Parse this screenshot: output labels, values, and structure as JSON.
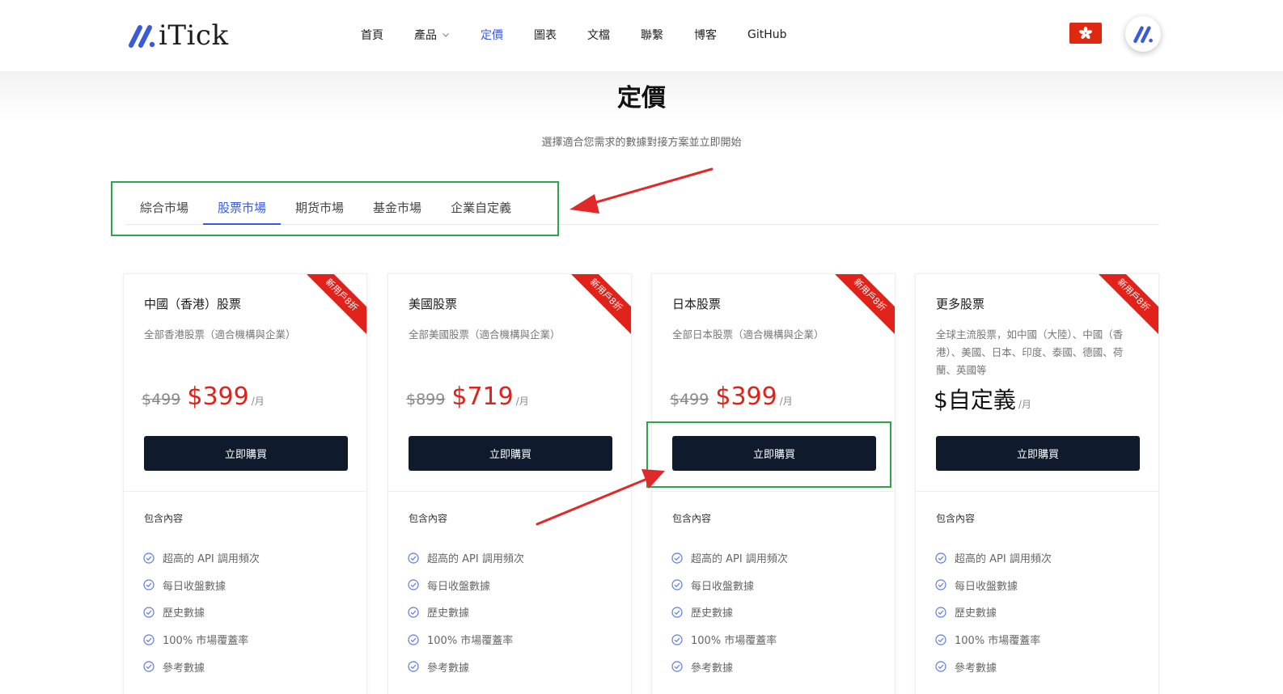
{
  "brand": {
    "logo_text": "iTick",
    "accent": "#3a5bd9"
  },
  "nav": {
    "items": [
      {
        "label": "首頁",
        "active": false,
        "has_dropdown": false
      },
      {
        "label": "產品",
        "active": false,
        "has_dropdown": true
      },
      {
        "label": "定價",
        "active": true,
        "has_dropdown": false
      },
      {
        "label": "圖表",
        "active": false,
        "has_dropdown": false
      },
      {
        "label": "文檔",
        "active": false,
        "has_dropdown": false
      },
      {
        "label": "聯繫",
        "active": false,
        "has_dropdown": false
      },
      {
        "label": "博客",
        "active": false,
        "has_dropdown": false
      },
      {
        "label": "GitHub",
        "active": false,
        "has_dropdown": false
      }
    ]
  },
  "page": {
    "title": "定價",
    "subtitle": "選擇適合您需求的數據對接方案並立即開始"
  },
  "tabs": [
    {
      "label": "綜合市場",
      "active": false
    },
    {
      "label": "股票市場",
      "active": true
    },
    {
      "label": "期货市場",
      "active": false
    },
    {
      "label": "基金市場",
      "active": false
    },
    {
      "label": "企業自定義",
      "active": false
    }
  ],
  "cards": [
    {
      "ribbon": "新用戶8折",
      "title": "中國（香港）股票",
      "desc": "全部香港股票（適合機構與企業）",
      "old_price": "$499",
      "price": "$399",
      "per": "/月",
      "button": "立即購買",
      "includes_label": "包含內容",
      "features": [
        "超高的 API 調用頻次",
        "每日收盤數據",
        "歷史數據",
        "100% 市場覆蓋率",
        "參考數據"
      ]
    },
    {
      "ribbon": "新用戶8折",
      "title": "美國股票",
      "desc": "全部美國股票（適合機構與企業）",
      "old_price": "$899",
      "price": "$719",
      "per": "/月",
      "button": "立即購買",
      "includes_label": "包含內容",
      "features": [
        "超高的 API 調用頻次",
        "每日收盤數據",
        "歷史數據",
        "100% 市場覆蓋率",
        "參考數據"
      ]
    },
    {
      "ribbon": "新用戶8折",
      "title": "日本股票",
      "desc": "全部日本股票（適合機構與企業）",
      "old_price": "$499",
      "price": "$399",
      "per": "/月",
      "button": "立即購買",
      "includes_label": "包含內容",
      "features": [
        "超高的 API 調用頻次",
        "每日收盤數據",
        "歷史數據",
        "100% 市場覆蓋率",
        "參考數據"
      ]
    },
    {
      "ribbon": "新用戶8折",
      "title": "更多股票",
      "desc": "全球主流股票，如中國（大陸）、中國（香港）、美國、日本、印度、泰國、德國、荷蘭、英國等",
      "old_price": "",
      "price": "$自定義",
      "per": "/月",
      "button": "立即購買",
      "includes_label": "包含內容",
      "features": [
        "超高的 API 調用頻次",
        "每日收盤數據",
        "歷史數據",
        "100% 市場覆蓋率",
        "參考數據"
      ]
    }
  ],
  "colors": {
    "sale_red": "#e0221b",
    "button_dark": "#0f1b2d",
    "annotation_green": "#2ea44f",
    "annotation_arrow": "#e02a2a"
  }
}
